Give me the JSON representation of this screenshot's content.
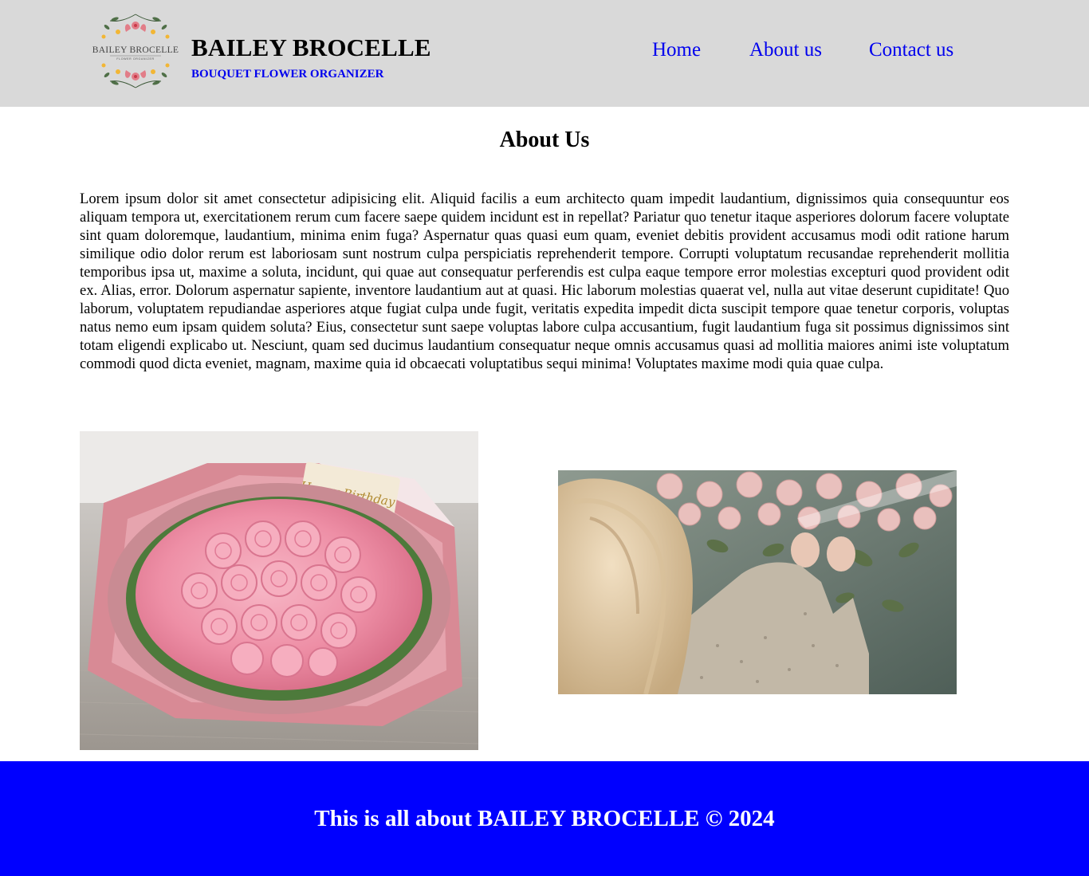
{
  "header": {
    "logo_icon": "bailey-brocelle-floral-logo",
    "logo_text": "BAILEY BROCELLE",
    "logo_subtext": "FLOWER ORGANIZER",
    "brand_title": "BAILEY BROCELLE",
    "brand_subtitle": "BOUQUET FLOWER ORGANIZER",
    "nav": [
      {
        "label": "Home"
      },
      {
        "label": "About us"
      },
      {
        "label": "Contact us"
      }
    ],
    "background_color": "#d9d9d9",
    "link_color": "#0000ee"
  },
  "main": {
    "heading": "About Us",
    "paragraph": "Lorem ipsum dolor sit amet consectetur adipisicing elit. Aliquid facilis a eum architecto quam impedit laudantium, dignissimos quia consequuntur eos aliquam tempora ut, exercitationem rerum cum facere saepe quidem incidunt est in repellat? Pariatur quo tenetur itaque asperiores dolorum facere voluptate sint quam doloremque, laudantium, minima enim fuga? Aspernatur quas quasi eum quam, eveniet debitis provident accusamus modi odit ratione harum similique odio dolor rerum est laboriosam sunt nostrum culpa perspiciatis reprehenderit tempore. Corrupti voluptatum recusandae reprehenderit mollitia temporibus ipsa ut, maxime a soluta, incidunt, qui quae aut consequatur perferendis est culpa eaque tempore error molestias excepturi quod provident odit ex. Alias, error. Dolorum aspernatur sapiente, inventore laudantium aut at quasi. Hic laborum molestias quaerat vel, nulla aut vitae deserunt cupiditate! Quo laborum, voluptatem repudiandae asperiores atque fugiat culpa unde fugit, veritatis expedita impedit dicta suscipit tempore quae tenetur corporis, voluptas natus nemo eum ipsam quidem soluta? Eius, consectetur sunt saepe voluptas labore culpa accusantium, fugit laudantium fuga sit possimus dignissimos sint totam eligendi explicabo ut. Nesciunt, quam sed ducimus laudantium consequatur neque omnis accusamus quasi ad mollitia maiores animi iste voluptatum commodi quod dicta eveniet, magnam, maxime quia id obcaecati voluptatibus sequi minima! Voluptates maxime modi quia quae culpa.",
    "images": [
      {
        "name": "pink-rose-bouquet-photo",
        "card_text": "Happy Birthday"
      },
      {
        "name": "florist-arranging-roses-photo"
      }
    ]
  },
  "footer": {
    "text": "This is all about BAILEY BROCELLE © 2024",
    "background_color": "#0000ff",
    "text_color": "#ffffff"
  }
}
